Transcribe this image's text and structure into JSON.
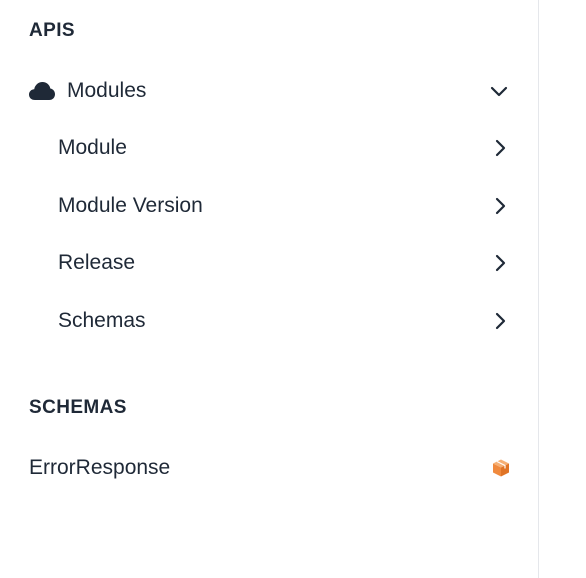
{
  "sections": {
    "apis": {
      "title": "APIS",
      "group": {
        "label": "Modules",
        "icon": "cloud-icon",
        "expanded": true,
        "items": [
          {
            "label": "Module",
            "icon": "chevron-right-icon"
          },
          {
            "label": "Module Version",
            "icon": "chevron-right-icon"
          },
          {
            "label": "Release",
            "icon": "chevron-right-icon"
          },
          {
            "label": "Schemas",
            "icon": "chevron-right-icon"
          }
        ]
      }
    },
    "schemas": {
      "title": "SCHEMAS",
      "items": [
        {
          "label": "ErrorResponse",
          "icon": "cube-icon",
          "icon_color": "#f08a3e"
        }
      ]
    }
  },
  "colors": {
    "text": "#1f2937",
    "divider": "#e5e7eb",
    "accent": "#f08a3e"
  }
}
